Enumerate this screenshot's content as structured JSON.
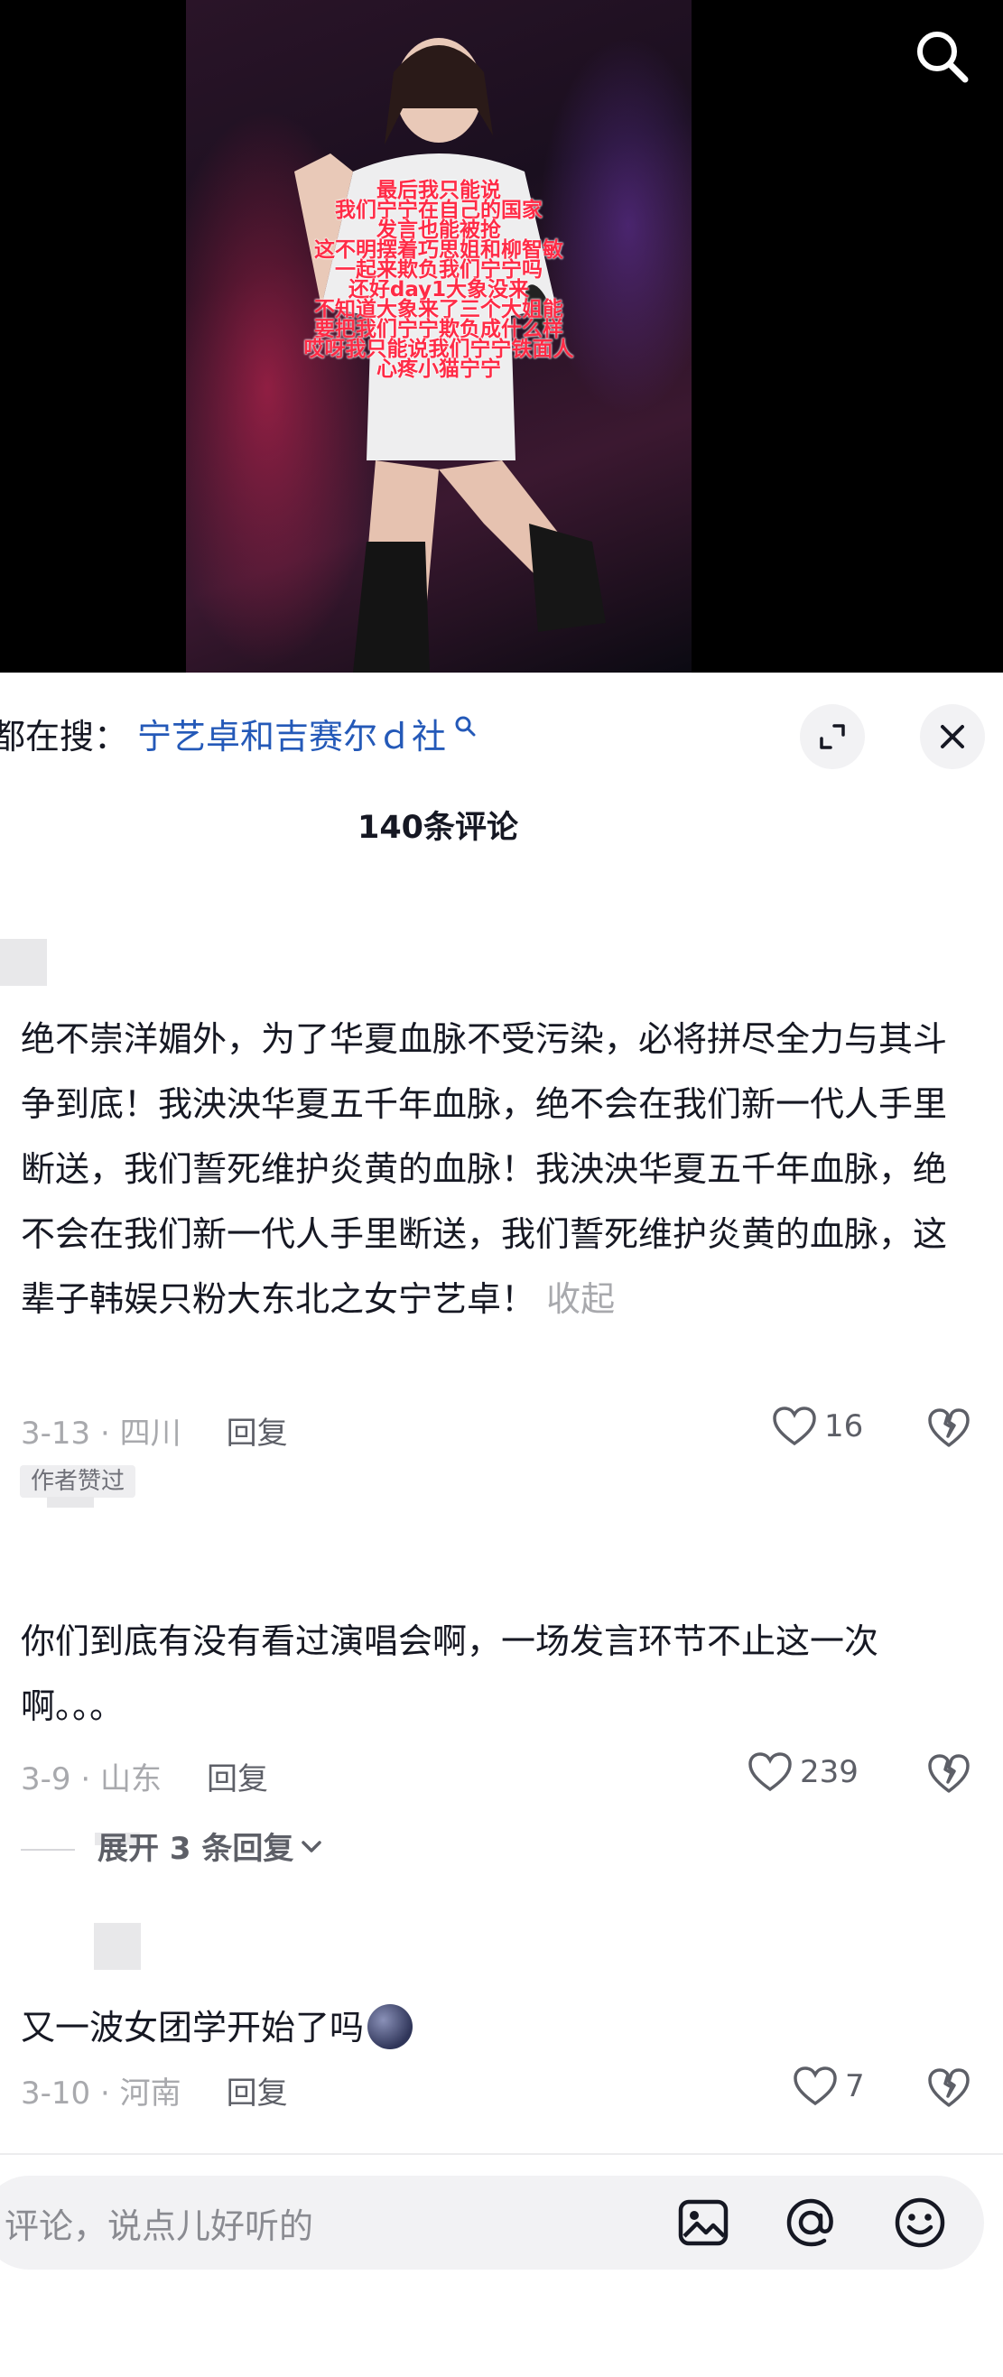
{
  "video": {
    "overlay_lines": [
      "最后我只能说",
      "我们宁宁在自己的国家",
      "发言也能被抢",
      "这不明摆着巧思姐和柳智敏",
      "一起来欺负我们宁宁吗",
      "还好day1大象没来",
      "不知道大象来了三个大姐能",
      "要把我们宁宁欺负成什么样",
      "哎呀我只能说我们宁宁铁面人",
      "心疼小猫宁宁"
    ]
  },
  "sheet": {
    "trend_prefix": "都在搜：",
    "trend_topic": "宁艺卓和吉赛尔ｄ社",
    "comment_count": "140条评论"
  },
  "comments": [
    {
      "text": "绝不崇洋媚外，为了华夏血脉不受污染，必将拼尽全力与其斗争到底！我泱泱华夏五千年血脉，绝不会在我们新一代人手里断送，我们誓死维护炎黄的血脉！我泱泱华夏五千年血脉，绝不会在我们新一代人手里断送，我们誓死维护炎黄的血脉，这辈子韩娱只粉大东北之女宁艺卓！",
      "collapse_label": "收起",
      "meta": "3-13 · 四川",
      "reply_label": "回复",
      "likes": "16",
      "badge": "作者赞过"
    },
    {
      "text": "你们到底有没有看过演唱会啊，一场发言环节不止这一次啊。。。",
      "meta": "3-9 · 山东",
      "reply_label": "回复",
      "likes": "239",
      "expand_label": "展开 3 条回复"
    },
    {
      "text": "又一波女团学开始了吗",
      "meta": "3-10 · 河南",
      "reply_label": "回复",
      "likes": "7"
    }
  ],
  "input": {
    "placeholder": "评论，说点儿好听的"
  }
}
